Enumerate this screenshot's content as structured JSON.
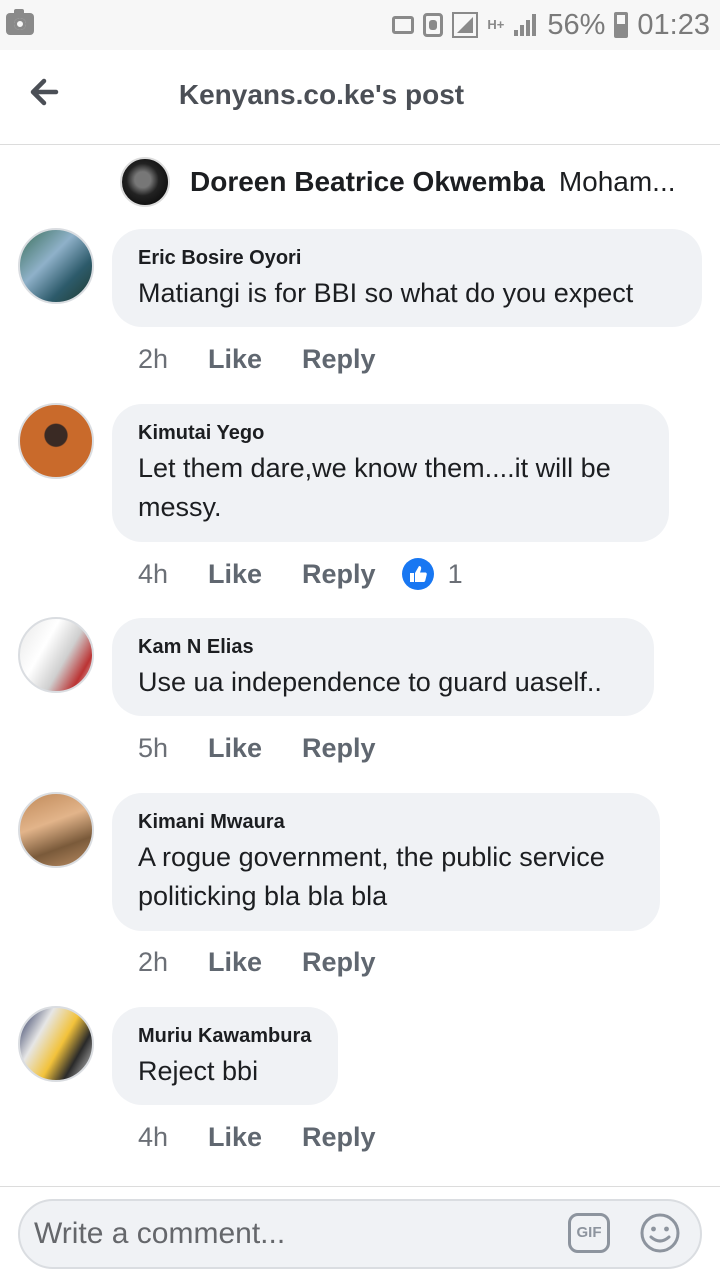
{
  "status_bar": {
    "battery_percent": "56%",
    "time": "01:23",
    "network_type": "H+",
    "icons": [
      "camera-icon",
      "cast-icon",
      "call-icon",
      "signal-icon",
      "hplus-icon",
      "signal-icon",
      "battery-icon"
    ]
  },
  "header": {
    "title": "Kenyans.co.ke's post",
    "back_icon": "arrow-left-icon"
  },
  "reply_preview": {
    "name": "Doreen Beatrice Okwemba",
    "text": "Moham..."
  },
  "comments": [
    {
      "name": "Eric Bosire Oyori",
      "text": "Matiangi is for BBI so what do you expect",
      "time": "2h",
      "like": "Like",
      "reply": "Reply",
      "reactions": null
    },
    {
      "name": "Kimutai Yego",
      "text": "Let them dare,we know them....it will be messy.",
      "time": "4h",
      "like": "Like",
      "reply": "Reply",
      "reactions": "1"
    },
    {
      "name": "Kam N Elias",
      "text": "Use ua independence to guard uaself..",
      "time": "5h",
      "like": "Like",
      "reply": "Reply",
      "reactions": null
    },
    {
      "name": "Kimani Mwaura",
      "text": "A rogue government, the public service politicking bla bla bla",
      "time": "2h",
      "like": "Like",
      "reply": "Reply",
      "reactions": null
    },
    {
      "name": "Muriu Kawambura",
      "text": "Reject bbi",
      "time": "4h",
      "like": "Like",
      "reply": "Reply",
      "reactions": null
    }
  ],
  "composer": {
    "placeholder": "Write a comment...",
    "gif_label": "GIF"
  },
  "colors": {
    "bubble": "#f0f2f5",
    "like_badge": "#1877f2",
    "muted_text": "#606770"
  }
}
